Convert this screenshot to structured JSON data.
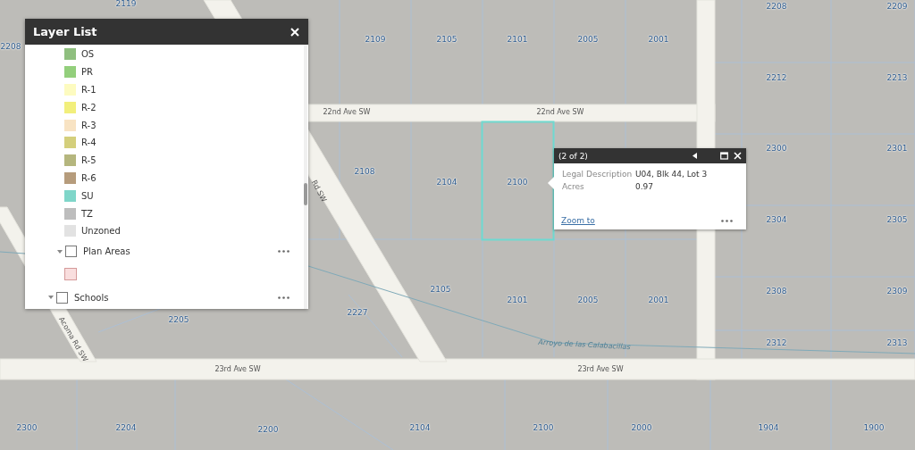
{
  "map": {
    "parcel_labels": [
      "2119",
      "2208",
      "2109",
      "2105",
      "2101",
      "2005",
      "2001",
      "2208",
      "2209",
      "2212",
      "2213",
      "2108",
      "2104",
      "2100",
      "2300",
      "2301",
      "2304",
      "2305",
      "2105",
      "2101",
      "2005",
      "2001",
      "2308",
      "2309",
      "2205",
      "2227",
      "2312",
      "2313",
      "2300",
      "2204",
      "2200",
      "2104",
      "2100",
      "2000",
      "1904",
      "1900"
    ],
    "street_labels": [
      "22nd Ave SW",
      "22nd Ave SW",
      "23rd Ave SW",
      "23rd Ave SW",
      "Acoma Rd SW",
      "Rd SW"
    ],
    "stream_label": "Arroyo de las Calabacillas"
  },
  "layer_list": {
    "title": "Layer List",
    "legend": [
      {
        "label": "OS",
        "color": "#8fbf7f"
      },
      {
        "label": "PR",
        "color": "#93cf7c"
      },
      {
        "label": "R-1",
        "color": "#fdfbc0"
      },
      {
        "label": "R-2",
        "color": "#f2ef7c"
      },
      {
        "label": "R-3",
        "color": "#f8e3c3"
      },
      {
        "label": "R-4",
        "color": "#d4cf7c"
      },
      {
        "label": "R-5",
        "color": "#b5b67e"
      },
      {
        "label": "R-6",
        "color": "#b69c7c"
      },
      {
        "label": "SU",
        "color": "#7fd6c9"
      },
      {
        "label": "TZ",
        "color": "#bdbdbd"
      },
      {
        "label": "Unzoned",
        "color": "#e2e2e2"
      }
    ],
    "layers": [
      {
        "label": "Plan Areas",
        "checked": false,
        "expanded": true,
        "color": "#f9dede"
      },
      {
        "label": "Schools",
        "checked": false,
        "expanded": true
      }
    ]
  },
  "popup": {
    "title": "(2 of 2)",
    "fields": [
      {
        "label": "Legal Description",
        "value": "U04, Blk 44, Lot 3"
      },
      {
        "label": "Acres",
        "value": "0.97"
      }
    ],
    "link": "Zoom to"
  }
}
